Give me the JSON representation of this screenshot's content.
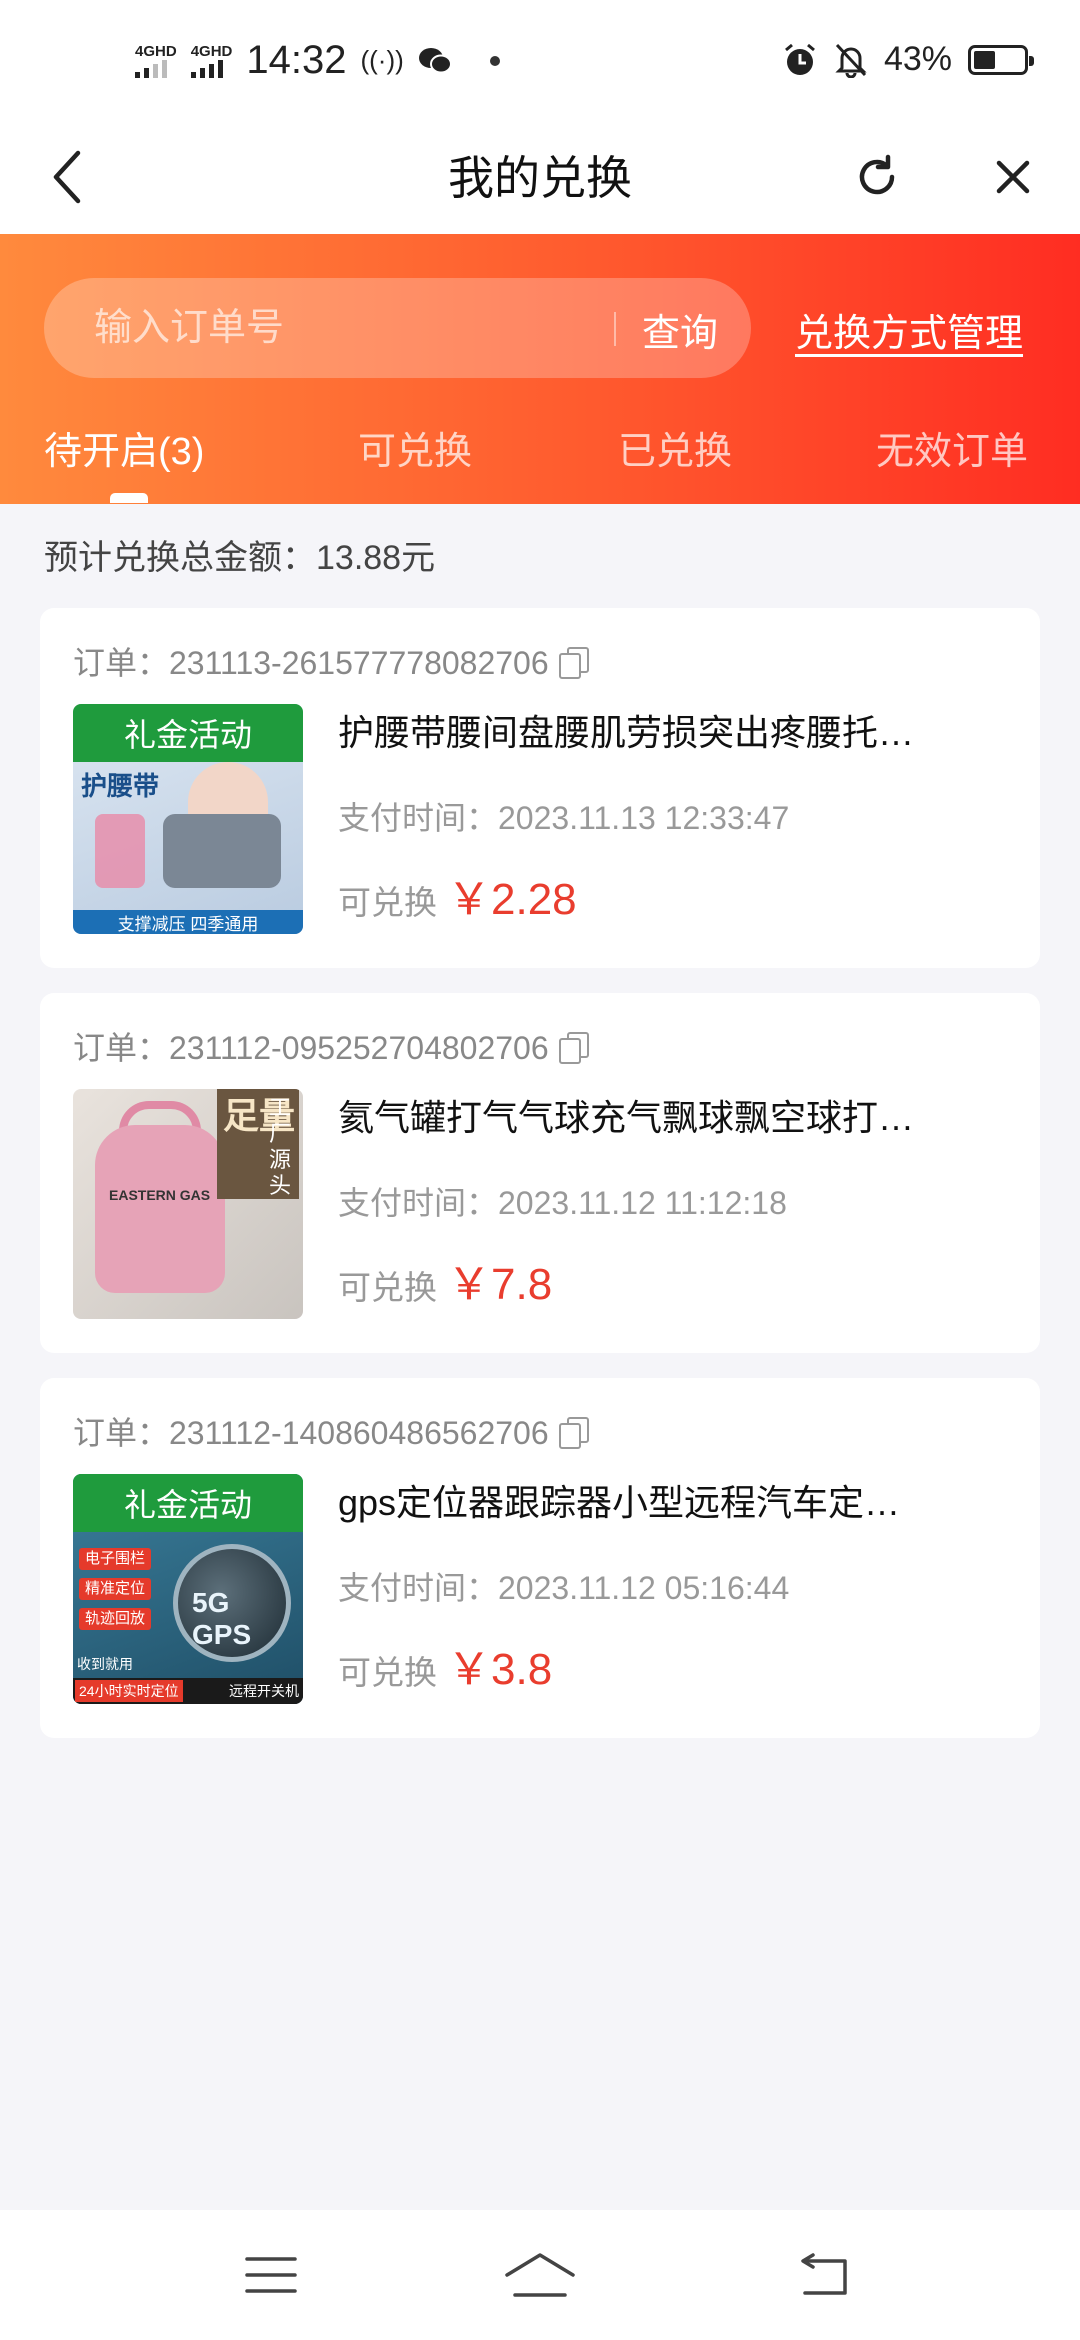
{
  "status_bar": {
    "network1": "4GHD",
    "network2": "4GHD",
    "time": "14:32",
    "battery_pct": "43%",
    "battery_level": 0.43
  },
  "titlebar": {
    "title": "我的兑换"
  },
  "header": {
    "search_placeholder": "输入订单号",
    "search_button": "查询",
    "manage_link": "兑换方式管理",
    "tabs": [
      {
        "label": "待开启(3)",
        "active": true
      },
      {
        "label": "可兑换",
        "active": false
      },
      {
        "label": "已兑换",
        "active": false
      },
      {
        "label": "无效订单",
        "active": false
      }
    ]
  },
  "summary": "预计兑换总金额：13.88元",
  "orders": [
    {
      "order_no": "订单：231113-261577778082706",
      "name": "护腰带腰间盘腰肌劳损突出疼腰托…",
      "pay_time": "支付时间：2023.11.13 12:33:47",
      "price_label": "可兑换",
      "price": "￥2.28",
      "thumb": {
        "banner": "礼金活动",
        "title": "护腰带",
        "bottom": "支撑减压 四季通用"
      }
    },
    {
      "order_no": "订单：231112-095252704802706",
      "name": "氦气罐打气气球充气飘球飘空球打…",
      "pay_time": "支付时间：2023.11.12 11:12:18",
      "price_label": "可兑换",
      "price": "￥7.8",
      "thumb": {
        "tank_label": "EASTERN GAS",
        "big": "足量",
        "small": "工厂源头"
      }
    },
    {
      "order_no": "订单：231112-140860486562706",
      "name": "gps定位器跟踪器小型远程汽车定…",
      "pay_time": "支付时间：2023.11.12 05:16:44",
      "price_label": "可兑换",
      "price": "￥3.8",
      "thumb": {
        "banner": "礼金活动",
        "tags": [
          "电子围栏",
          "精准定位",
          "轨迹回放"
        ],
        "disc": "5G GPS",
        "tl": "收到就用",
        "red": "24小时实时定位",
        "wt": "远程开关机"
      }
    }
  ],
  "colors": {
    "accent": "#ff5a2e",
    "price": "#e93d2e",
    "banner_green": "#1f9b3d"
  }
}
